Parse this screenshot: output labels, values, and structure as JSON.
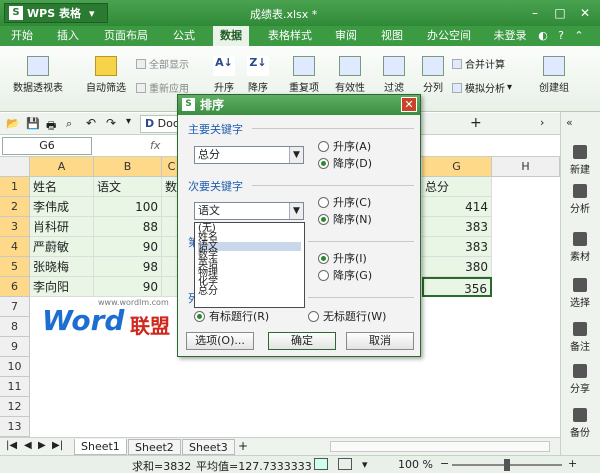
{
  "app": {
    "name": "WPS 表格",
    "doc_title": "成绩表.xlsx *"
  },
  "menubar": {
    "items": [
      "开始",
      "插入",
      "页面布局",
      "公式",
      "数据",
      "表格样式",
      "审阅",
      "视图",
      "办公空间"
    ],
    "active": "数据",
    "login": "未登录"
  },
  "ribbon": {
    "pivot": "数据透视表",
    "autofilter": "自动筛选",
    "show_all": "全部显示",
    "reapply": "重新应用",
    "asc": "升序",
    "desc": "降序",
    "dup": "重复项",
    "validity": "有效性",
    "filter": "过滤",
    "split": "分列",
    "consolidate": "合并计算",
    "whatif": "模拟分析",
    "group": "创建组"
  },
  "tabs": {
    "doc_tab": "Doc"
  },
  "formula": {
    "namebox": "G6",
    "fx": "fx"
  },
  "grid": {
    "columns": [
      "A",
      "B",
      "C",
      "D",
      "E",
      "F",
      "G",
      "H"
    ],
    "rows": [
      "1",
      "2",
      "3",
      "4",
      "5",
      "6",
      "7",
      "8",
      "9",
      "10",
      "11",
      "12",
      "13"
    ],
    "header_row": [
      "姓名",
      "语文",
      "数",
      "总分"
    ],
    "data": [
      {
        "name": "李伟成",
        "chinese": "100",
        "total": "414"
      },
      {
        "name": "肖科研",
        "chinese": "88",
        "total": "383"
      },
      {
        "name": "严蔚敏",
        "chinese": "90",
        "total": "383"
      },
      {
        "name": "张晓梅",
        "chinese": "98",
        "total": "380"
      },
      {
        "name": "李向阳",
        "chinese": "90",
        "total": "356"
      }
    ]
  },
  "right_panel": [
    "新建",
    "分析",
    "素材",
    "选择",
    "备注",
    "分享",
    "备份"
  ],
  "sheets": [
    "Sheet1",
    "Sheet2",
    "Sheet3"
  ],
  "status": {
    "sum": "求和=3832",
    "avg": "平均值=127.7333333",
    "zoom": "100 %"
  },
  "dialog": {
    "title": "排序",
    "primary_label": "主要关键字",
    "primary_value": "总分",
    "primary_asc": "升序(A)",
    "primary_desc": "降序(D)",
    "secondary_label": "次要关键字",
    "secondary_value": "语文",
    "secondary_asc": "升序(C)",
    "secondary_desc": "降序(N)",
    "third_label": "第",
    "third_asc": "升序(I)",
    "third_desc": "降序(G)",
    "list_label": "列",
    "has_header": "有标题行(R)",
    "no_header": "无标题行(W)",
    "options": "选项(O)...",
    "ok": "确定",
    "cancel": "取消",
    "dropdown_items": [
      "(无)",
      "姓名",
      "语文",
      "数学",
      "英语",
      "物理",
      "化学",
      "总分"
    ],
    "dropdown_highlight": "语文"
  },
  "watermark": {
    "word": "Word",
    "brand": "联盟",
    "url": "www.wordlm.com"
  },
  "colors": {
    "accent": "#3c9a43",
    "dialog_title": "#4a9e50",
    "data_fill": "#e9f6e6"
  }
}
